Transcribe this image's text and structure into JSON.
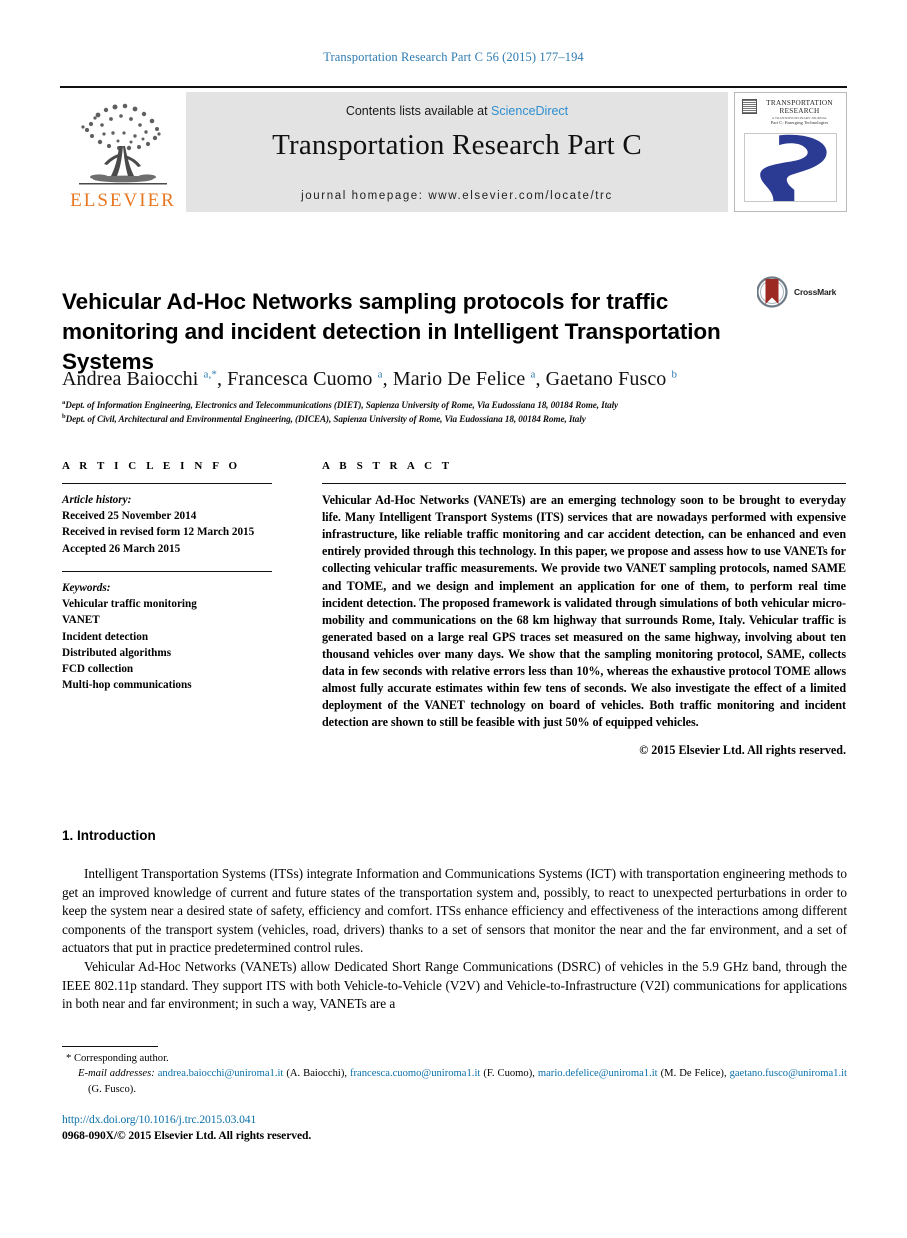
{
  "running_head": "Transportation Research Part C 56 (2015) 177–194",
  "masthead": {
    "contents_prefix": "Contents lists available at ",
    "sciencedirect": "ScienceDirect",
    "journal_title": "Transportation Research Part C",
    "homepage": "journal homepage: www.elsevier.com/locate/trc",
    "publisher_logo_text": "ELSEVIER",
    "cover": {
      "line1": "TRANSPORTATION",
      "line2": "RESEARCH",
      "line3": "A TRANSDISCIPLINARY JOURNAL",
      "line4": "Part C: Emerging Technologies"
    }
  },
  "article": {
    "title": "Vehicular Ad-Hoc Networks sampling protocols for traffic monitoring and incident detection in Intelligent Transportation Systems",
    "crossmark_label": "CrossMark",
    "authors_html": "Andrea Baiocchi <sup>a,*</sup>, Francesca Cuomo <sup>a</sup>, Mario De Felice <sup>a</sup>, Gaetano Fusco <sup>b</sup>",
    "affiliations": [
      {
        "marker": "a",
        "text": "Dept. of Information Engineering, Electronics and Telecommunications (DIET), Sapienza University of Rome, Via Eudossiana 18, 00184 Rome, Italy"
      },
      {
        "marker": "b",
        "text": "Dept. of Civil, Architectural and Environmental Engineering, (DICEA), Sapienza University of Rome, Via Eudossiana 18, 00184 Rome, Italy"
      }
    ]
  },
  "article_info": {
    "heading": "A R T I C L E    I N F O",
    "history_label": "Article history:",
    "history": [
      "Received 25 November 2014",
      "Received in revised form 12 March 2015",
      "Accepted 26 March 2015"
    ],
    "keywords_label": "Keywords:",
    "keywords": [
      "Vehicular traffic monitoring",
      "VANET",
      "Incident detection",
      "Distributed algorithms",
      "FCD collection",
      "Multi-hop communications"
    ]
  },
  "abstract": {
    "heading": "A B S T R A C T",
    "text": "Vehicular Ad-Hoc Networks (VANETs) are an emerging technology soon to be brought to everyday life. Many Intelligent Transport Systems (ITS) services that are nowadays performed with expensive infrastructure, like reliable traffic monitoring and car accident detection, can be enhanced and even entirely provided through this technology. In this paper, we propose and assess how to use VANETs for collecting vehicular traffic measurements. We provide two VANET sampling protocols, named SAME and TOME, and we design and implement an application for one of them, to perform real time incident detection. The proposed framework is validated through simulations of both vehicular micro-mobility and communications on the 68 km highway that surrounds Rome, Italy. Vehicular traffic is generated based on a large real GPS traces set measured on the same highway, involving about ten thousand vehicles over many days. We show that the sampling monitoring protocol, SAME, collects data in few seconds with relative errors less than 10%, whereas the exhaustive protocol TOME allows almost fully accurate estimates within few tens of seconds. We also investigate the effect of a limited deployment of the VANET technology on board of vehicles. Both traffic monitoring and incident detection are shown to still be feasible with just 50% of equipped vehicles.",
    "copyright": "© 2015 Elsevier Ltd. All rights reserved."
  },
  "body": {
    "section_heading": "1. Introduction",
    "paragraphs": [
      "Intelligent Transportation Systems (ITSs) integrate Information and Communications Systems (ICT) with transportation engineering methods to get an improved knowledge of current and future states of the transportation system and, possibly, to react to unexpected perturbations in order to keep the system near a desired state of safety, efficiency and comfort. ITSs enhance efficiency and effectiveness of the interactions among different components of the transport system (vehicles, road, drivers) thanks to a set of sensors that monitor the near and the far environment, and a set of actuators that put in practice predetermined control rules.",
      "Vehicular Ad-Hoc Networks (VANETs) allow Dedicated Short Range Communications (DSRC) of vehicles in the 5.9 GHz band, through the IEEE 802.11p standard. They support ITS with both Vehicle-to-Vehicle (V2V) and Vehicle-to-Infrastructure (V2I) communications for applications in both near and far environment; in such a way, VANETs are a"
    ]
  },
  "footnotes": {
    "corresponding": "* Corresponding author.",
    "email_label": "E-mail addresses:",
    "emails": [
      {
        "address": "andrea.baiocchi@uniroma1.it",
        "person": "(A. Baiocchi)"
      },
      {
        "address": "francesca.cuomo@uniroma1.it",
        "person": "(F. Cuomo)"
      },
      {
        "address": "mario.defelice@uniroma1.it",
        "person": "(M. De Felice)"
      },
      {
        "address": "gaetano.fusco@uniroma1.it",
        "person": "(G. Fusco)"
      }
    ]
  },
  "footer": {
    "doi": "http://dx.doi.org/10.1016/j.trc.2015.03.041",
    "issn_line": "0968-090X/© 2015 Elsevier Ltd. All rights reserved."
  },
  "colors": {
    "journal_blue": "#2e7bb0",
    "link_blue": "#0a6fa8",
    "sciencedirect_blue": "#2e8fd0",
    "elsevier_orange": "#E87722",
    "masthead_gray": "#e3e3e3",
    "cover_blue": "#2b3a93",
    "crossmark_red": "#9c2a22"
  }
}
